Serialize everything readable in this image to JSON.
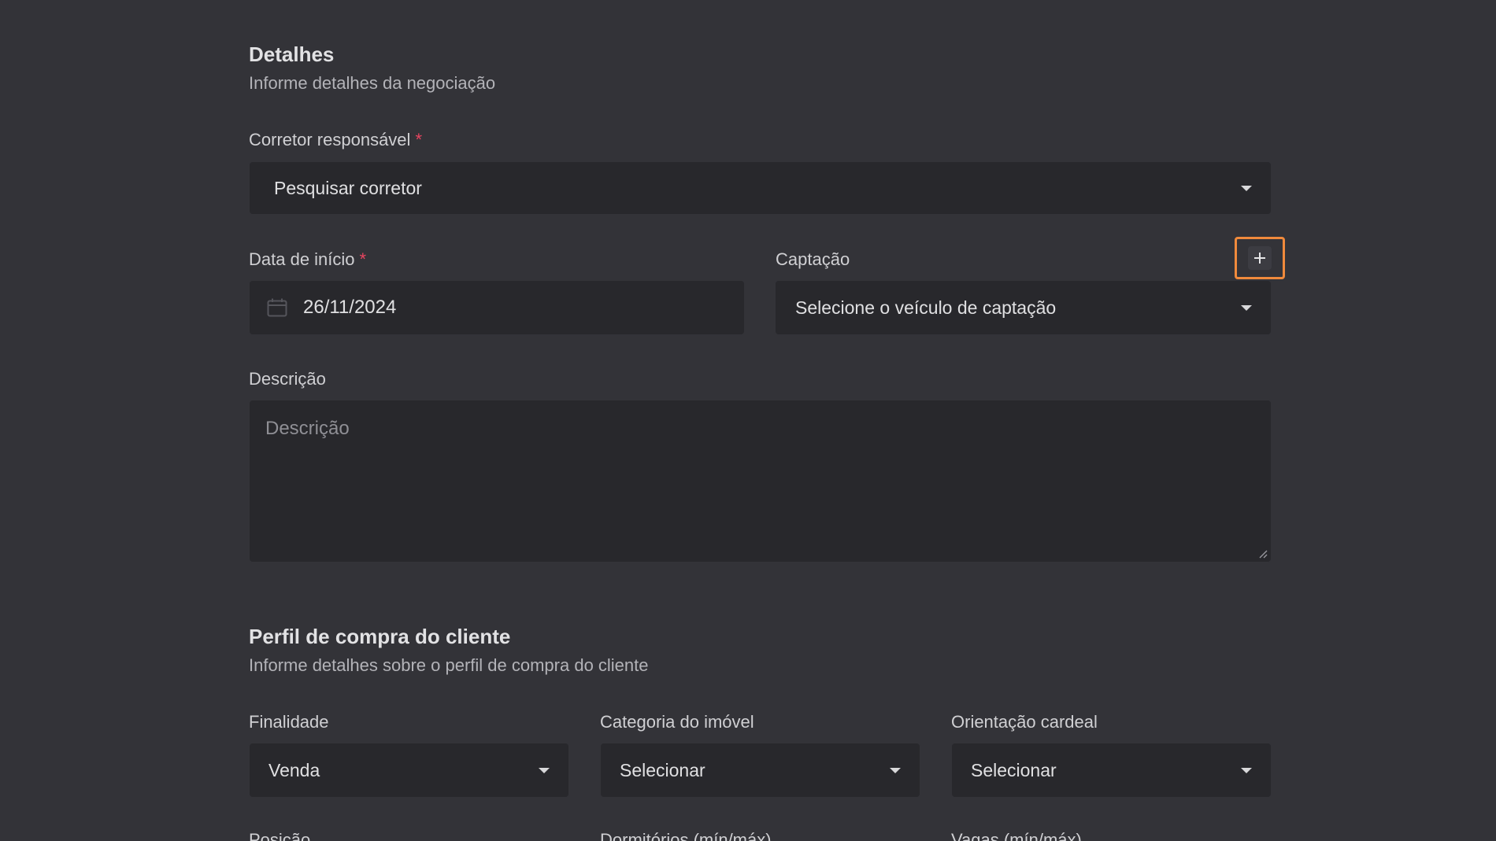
{
  "details": {
    "title": "Detalhes",
    "subtitle": "Informe detalhes da negociação",
    "broker": {
      "label": "Corretor responsável",
      "required_mark": "*",
      "placeholder": "Pesquisar corretor"
    },
    "start_date": {
      "label": "Data de início",
      "required_mark": "*",
      "value": "26/11/2024"
    },
    "capture": {
      "label": "Captação",
      "placeholder": "Selecione o veículo de captação",
      "add_icon": "plus-icon"
    },
    "description": {
      "label": "Descrição",
      "placeholder": "Descrição"
    }
  },
  "profile": {
    "title": "Perfil de compra do cliente",
    "subtitle": "Informe detalhes sobre o perfil de compra do cliente",
    "purpose": {
      "label": "Finalidade",
      "value": "Venda"
    },
    "category": {
      "label": "Categoria do imóvel",
      "value": "Selecionar"
    },
    "orientation": {
      "label": "Orientação cardeal",
      "value": "Selecionar"
    },
    "cut_labels": {
      "position": "Posição",
      "bedrooms": "Dormitórios (mín/máx)",
      "parking": "Vagas (mín/máx)"
    }
  },
  "colors": {
    "background": "#333338",
    "field": "#28282c",
    "accent": "#f08a3c",
    "required": "#e94560"
  }
}
